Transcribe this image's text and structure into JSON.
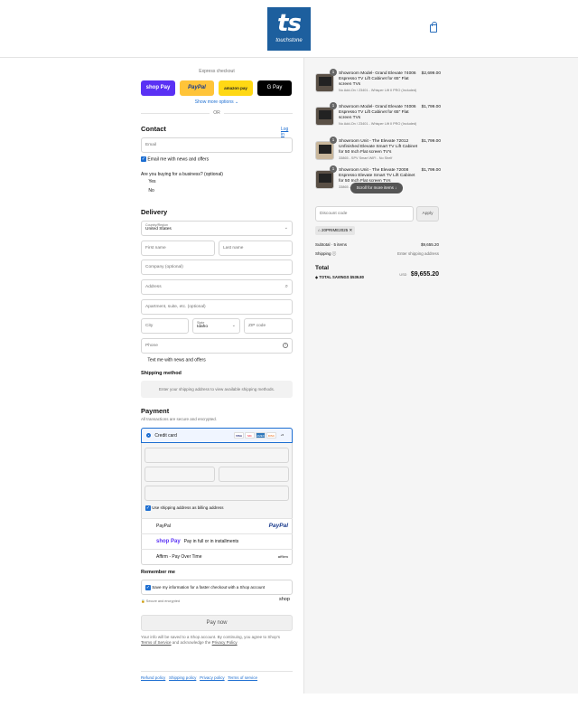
{
  "header": {
    "logo_text": "ts",
    "logo_brand": "touchstone",
    "cart_icon": "shopping-bag-icon",
    "brand_color": "#1d5f9e"
  },
  "express": {
    "label": "Express checkout",
    "shop_pay": "shop Pay",
    "paypal": "PayPal",
    "amazon_pay": "amazon pay",
    "gpay": "G Pay",
    "show_more": "Show more options",
    "or": "OR"
  },
  "contact": {
    "heading": "Contact",
    "login": "Log in",
    "email_placeholder": "Email",
    "email_news": "Email me with news and offers",
    "business_question": "Are you buying for a business? (optional)",
    "yes": "Yes",
    "no": "No"
  },
  "delivery": {
    "heading": "Delivery",
    "country_label": "Country/Region",
    "country_value": "United States",
    "first_name": "First name",
    "last_name": "Last name",
    "company": "Company (optional)",
    "address": "Address",
    "apartment": "Apartment, suite, etc. (optional)",
    "city": "City",
    "state_label": "State",
    "state_value": "Idaho",
    "zip": "ZIP code",
    "phone": "Phone",
    "text_news": "Text me with news and offers"
  },
  "shipping": {
    "heading": "Shipping method",
    "message": "Enter your shipping address to view available shipping methods."
  },
  "payment": {
    "heading": "Payment",
    "subtitle": "All transactions are secure and encrypted.",
    "credit_card": "Credit card",
    "card_brands": [
      "VISA",
      "MC",
      "AMEX",
      "DISC"
    ],
    "more_cards": "+5",
    "billing": "Use shipping address as billing address",
    "paypal": "PayPal",
    "shoppay_text": "Pay in full or in installments",
    "shoppay_logo": "shop Pay",
    "affirm": "Affirm - Pay Over Time",
    "affirm_logo": "affirm"
  },
  "remember": {
    "heading": "Remember me",
    "save_info": "Save my information for a faster checkout with a Shop account",
    "secure": "Secure and encrypted",
    "shop_logo": "shop"
  },
  "pay_now": "Pay now",
  "legal": {
    "text": "Your info will be saved to a Shop account. By continuing, you agree to Shop's",
    "terms": "Terms of Service",
    "and": "and acknowledge the",
    "privacy": "Privacy Policy"
  },
  "footer": {
    "refund": "Refund policy",
    "shipping": "Shipping policy",
    "privacy": "Privacy policy",
    "terms": "Terms of service"
  },
  "order": {
    "items": [
      {
        "qty": "1",
        "name": "Showroom Model- Grand Elevate 74006 Espresso TV Lift Cabinet for 65\" Flat screen TVs",
        "sub": "No Add-On / 23401 - Whisper Lift II PRO (Included)",
        "price": "$2,699.00"
      },
      {
        "qty": "1",
        "name": "Showroom Model- Grand Elevate 74006 Espresso TV Lift Cabinet for 65\" Flat screen TVs",
        "sub": "No Add-On / 23401 - Whisper Lift II PRO (Included)",
        "price": "$1,799.00"
      },
      {
        "qty": "1",
        "name": "Showroom Unit - The Elevate 72012 Unfinished Elevate Smart TV Lift Cabinet for 50 Inch Flat screen TV's",
        "sub": "33865 - SPV Smart WiFi - No Shelf",
        "price": "$1,799.00"
      },
      {
        "qty": "1",
        "name": "Showroom Unit - The Elevate 72008 Espresso Elevate Smart TV Lift Cabinet for 50 Inch Flat screen TVs",
        "sub": "33865 -",
        "price": "$1,799.00"
      }
    ],
    "scroll_hint": "Scroll for more items",
    "discount_placeholder": "Discount code",
    "apply": "Apply",
    "discount_tag": "20PRIME2025",
    "subtotal_label": "Subtotal · 5 items",
    "subtotal_value": "$9,655.20",
    "shipping_label": "Shipping",
    "shipping_value": "Enter shipping address",
    "total_label": "Total",
    "currency": "USD",
    "total_value": "$9,655.20",
    "savings_label": "TOTAL SAVINGS",
    "savings_value": "$539.80"
  }
}
